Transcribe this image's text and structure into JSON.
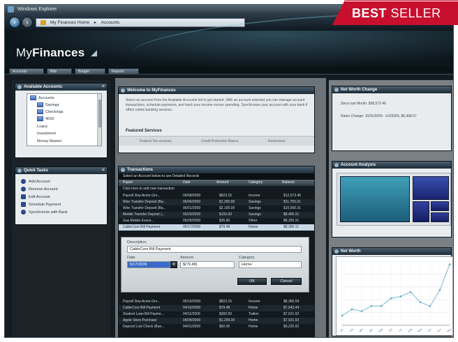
{
  "window": {
    "title": "Windows Explorer"
  },
  "address": {
    "path": [
      "My Finances Home",
      "Accounts"
    ]
  },
  "app": {
    "title_light": "My",
    "title_bold": "Finances"
  },
  "tabs": [
    "Accounts",
    "Bills",
    "Budget",
    "Reports"
  ],
  "available_accounts": {
    "title": "Available Accounts",
    "items": [
      "Accounts",
      "Savings",
      "Checkings",
      "401K",
      "Loans",
      "Investment",
      "Money Market"
    ]
  },
  "quick_tasks": {
    "title": "Quick Tasks",
    "items": [
      "Add Account",
      "Remove Account",
      "Edit Account",
      "Schedule Payment",
      "Synchronize with Bank"
    ]
  },
  "welcome": {
    "title": "Welcome to MyFinances",
    "text": "Select an account from the Available Accounts list to get started. With an account selected you can manage account transactions, schedule payments, and track your income versus spending. Synchronize your account with your bank if offers online banking services.",
    "featured_title": "Featured Services",
    "featured_links": [
      "Federal Tax services",
      "Credit Protection Basics",
      "Retirement"
    ]
  },
  "transactions": {
    "title": "Transactions",
    "subtitle": "Select an Account below to see Detailed Records",
    "columns": [
      "Payee",
      "Date",
      "Amount",
      "Category",
      "Balance"
    ],
    "note": "Click here to add new transaction",
    "rows": [
      [
        "Payroll Dep Acme Gro...",
        "06/08/2009",
        "$823.15",
        "Income",
        "$12,573.46"
      ],
      [
        "Wire Transfer Deposit (Ba...",
        "06/06/2009",
        "$1,250.00",
        "Savings",
        "$11,750.31"
      ],
      [
        "Wire Transfer Deposit (Ba...",
        "06/01/2009",
        "$2,100.00",
        "Savings",
        "$10,500.31"
      ],
      [
        "Mobile Transfer Deposit (...",
        "05/29/2009",
        "$150.00",
        "Savings",
        "$8,400.31"
      ],
      [
        "Gas Mobile Exxon...",
        "05/25/2009",
        "$35.80",
        "Other",
        "$8,250.31"
      ],
      [
        "CableCore Bill Payment",
        "05/17/2009",
        "$79.48",
        "Home",
        "$8,286.11"
      ],
      [
        "Payroll Dep Acme Gro...",
        "05/15/2009",
        "$823.15",
        "Income",
        "$8,365.59"
      ],
      [
        "CableCore Bill Payment",
        "04/16/2009",
        "$79.48",
        "Home",
        "$7,542.44"
      ],
      [
        "Student Loan Bill Payme...",
        "04/11/2009",
        "$300.00",
        "Tuition",
        "$7,621.92"
      ],
      [
        "Apple Store Purchase",
        "04/04/2009",
        "$1,299.00",
        "Home",
        "$7,921.92"
      ],
      [
        "Deposit Lost Check (Ban...",
        "04/01/2009",
        "$50.00",
        "Home",
        "$9,220.92"
      ]
    ],
    "editor": {
      "description_label": "Description",
      "description_value": "CableCore Bill Payment",
      "date_label": "Date",
      "date_value": "5/17/2009",
      "amount_label": "Amount",
      "amount_value": "$(79.48)",
      "category_label": "Category",
      "category_value": "Home",
      "ok_label": "OK",
      "cancel_label": "Cancel"
    }
  },
  "net_worth_change": {
    "title": "Net Worth Change",
    "line1": "Since last Month: $28,573.46",
    "line2": "Rates Change: 10/31/2009 - 4.0/2009, $6,498.57"
  },
  "account_analysis": {
    "title": "Account Analysis"
  },
  "net_worth": {
    "title": "Net Worth"
  },
  "chart_data": {
    "type": "line",
    "title": "Net Worth",
    "x": [
      "Jan",
      "Feb",
      "Mar",
      "Apr",
      "May",
      "Jun",
      "Jul",
      "Aug",
      "Sep",
      "Oct",
      "Nov",
      "Dec"
    ],
    "series": [
      {
        "values": [
          15,
          25,
          22,
          30,
          30,
          42,
          45,
          52,
          36,
          30,
          55,
          95
        ]
      }
    ],
    "ylim": [
      0,
      100
    ],
    "grid": true
  },
  "badge": {
    "text_bold": "BEST",
    "text_rest": "SELLER"
  }
}
